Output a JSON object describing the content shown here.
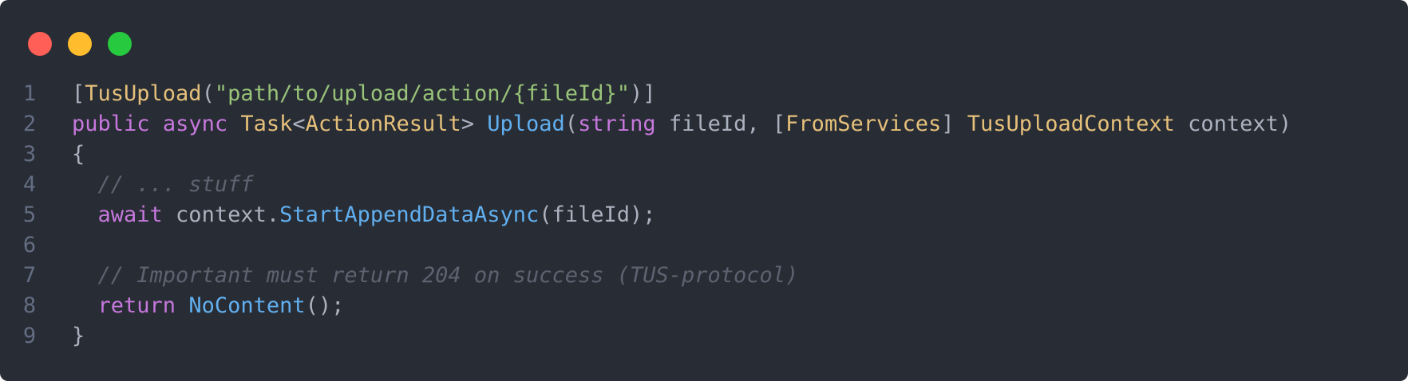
{
  "window_controls": {
    "close_color": "#ff5f56",
    "minimize_color": "#ffbd2e",
    "maximize_color": "#27c93f"
  },
  "code": {
    "language": "csharp",
    "lines": [
      {
        "number": "1",
        "tokens": [
          {
            "text": "[",
            "kind": "plain"
          },
          {
            "text": "TusUpload",
            "kind": "type"
          },
          {
            "text": "(",
            "kind": "plain"
          },
          {
            "text": "\"path/to/upload/action/{fileId}\"",
            "kind": "str"
          },
          {
            "text": ")]",
            "kind": "plain"
          }
        ]
      },
      {
        "number": "2",
        "tokens": [
          {
            "text": "public",
            "kind": "kw"
          },
          {
            "text": " ",
            "kind": "plain"
          },
          {
            "text": "async",
            "kind": "kw"
          },
          {
            "text": " ",
            "kind": "plain"
          },
          {
            "text": "Task",
            "kind": "type"
          },
          {
            "text": "<",
            "kind": "plain"
          },
          {
            "text": "ActionResult",
            "kind": "type"
          },
          {
            "text": "> ",
            "kind": "plain"
          },
          {
            "text": "Upload",
            "kind": "fn"
          },
          {
            "text": "(",
            "kind": "plain"
          },
          {
            "text": "string",
            "kind": "kw"
          },
          {
            "text": " fileId, [",
            "kind": "plain"
          },
          {
            "text": "FromServices",
            "kind": "type"
          },
          {
            "text": "] ",
            "kind": "plain"
          },
          {
            "text": "TusUploadContext",
            "kind": "type"
          },
          {
            "text": " context)",
            "kind": "plain"
          }
        ]
      },
      {
        "number": "3",
        "tokens": [
          {
            "text": "{",
            "kind": "plain"
          }
        ]
      },
      {
        "number": "4",
        "tokens": [
          {
            "text": "  ",
            "kind": "plain"
          },
          {
            "text": "// ... stuff",
            "kind": "cmt"
          }
        ]
      },
      {
        "number": "5",
        "tokens": [
          {
            "text": "  ",
            "kind": "plain"
          },
          {
            "text": "await",
            "kind": "kw"
          },
          {
            "text": " context.",
            "kind": "plain"
          },
          {
            "text": "StartAppendDataAsync",
            "kind": "fn"
          },
          {
            "text": "(fileId);",
            "kind": "plain"
          }
        ]
      },
      {
        "number": "6",
        "tokens": []
      },
      {
        "number": "7",
        "tokens": [
          {
            "text": "  ",
            "kind": "plain"
          },
          {
            "text": "// Important must return 204 on success (TUS-protocol)",
            "kind": "cmt"
          }
        ]
      },
      {
        "number": "8",
        "tokens": [
          {
            "text": "  ",
            "kind": "plain"
          },
          {
            "text": "return",
            "kind": "kw"
          },
          {
            "text": " ",
            "kind": "plain"
          },
          {
            "text": "NoContent",
            "kind": "fn"
          },
          {
            "text": "();",
            "kind": "plain"
          }
        ]
      },
      {
        "number": "9",
        "tokens": [
          {
            "text": "}",
            "kind": "plain"
          }
        ]
      }
    ]
  }
}
